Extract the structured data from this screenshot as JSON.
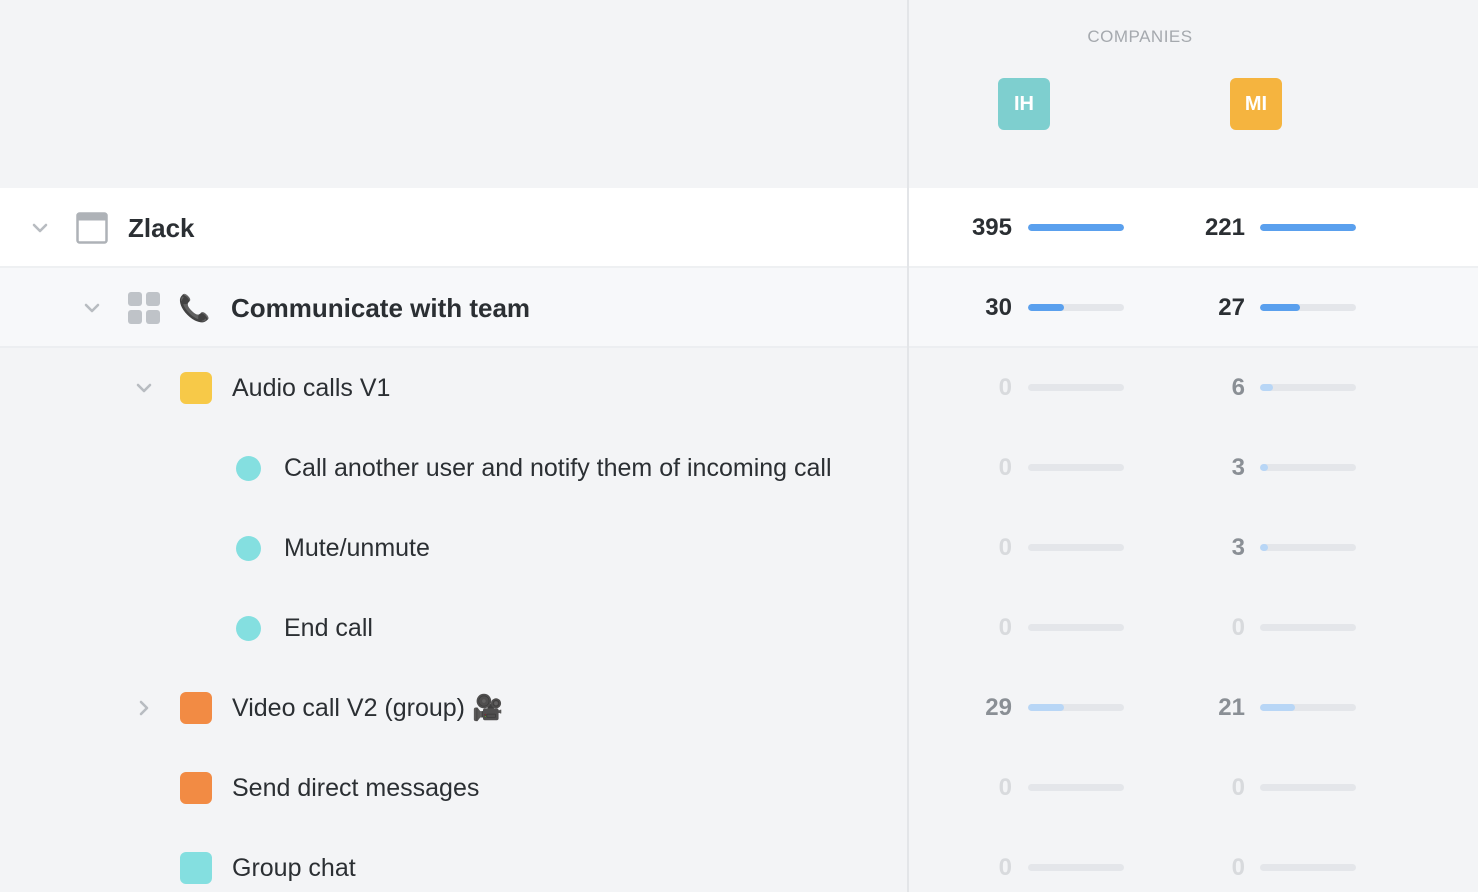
{
  "header": {
    "companies_label": "COMPANIES",
    "companies": [
      {
        "initials": "IH",
        "color": "#7ecfcf"
      },
      {
        "initials": "MI",
        "color": "#f5b43f"
      }
    ]
  },
  "rows": [
    {
      "label": "Zlack",
      "level": 0,
      "expanded": true,
      "icon": "window-icon",
      "values": [
        395,
        221
      ],
      "value_color": "#2b2f33",
      "fills": [
        1.0,
        1.0
      ],
      "fill_color": "#5aa0ee"
    },
    {
      "label": "Communicate with team",
      "level": 1,
      "expanded": true,
      "icon": "grid-icon",
      "emoji": "📞",
      "values": [
        30,
        27
      ],
      "value_color": "#2b2f33",
      "fills": [
        0.37,
        0.42
      ],
      "fill_color": "#5aa0ee"
    },
    {
      "label": "Audio calls V1",
      "level": 2,
      "expanded": true,
      "color": "#f7c948",
      "values": [
        0,
        6
      ],
      "value_colors": [
        "#d8dadd",
        "#8a8f95"
      ],
      "fills": [
        0,
        0.14
      ],
      "fill_color": "#b8d6f6"
    },
    {
      "label": "Call another user and notify them of incoming call",
      "level": 3,
      "color": "#84dfe0",
      "values": [
        0,
        3
      ],
      "value_colors": [
        "#d8dadd",
        "#8a8f95"
      ],
      "fills": [
        0,
        0.08
      ],
      "fill_color": "#b8d6f6"
    },
    {
      "label": "Mute/unmute",
      "level": 3,
      "color": "#84dfe0",
      "values": [
        0,
        3
      ],
      "value_colors": [
        "#d8dadd",
        "#8a8f95"
      ],
      "fills": [
        0,
        0.08
      ],
      "fill_color": "#b8d6f6"
    },
    {
      "label": "End call",
      "level": 3,
      "color": "#84dfe0",
      "values": [
        0,
        0
      ],
      "value_colors": [
        "#d8dadd",
        "#d8dadd"
      ],
      "fills": [
        0,
        0
      ],
      "fill_color": "#b8d6f6"
    },
    {
      "label": "Video call V2 (group) 🎥",
      "level": 2,
      "expanded": false,
      "color": "#f28b44",
      "values": [
        29,
        21
      ],
      "value_colors": [
        "#8a8f95",
        "#8a8f95"
      ],
      "fills": [
        0.37,
        0.36
      ],
      "fill_color": "#b8d6f6"
    },
    {
      "label": "Send direct messages",
      "level": 2,
      "color": "#f28b44",
      "values": [
        0,
        0
      ],
      "value_colors": [
        "#d8dadd",
        "#d8dadd"
      ],
      "fills": [
        0,
        0
      ],
      "fill_color": "#b8d6f6"
    },
    {
      "label": "Group chat",
      "level": 2,
      "color": "#84dfe0",
      "values": [
        0,
        0
      ],
      "value_colors": [
        "#d8dadd",
        "#d8dadd"
      ],
      "fills": [
        0,
        0
      ],
      "fill_color": "#b8d6f6"
    }
  ]
}
